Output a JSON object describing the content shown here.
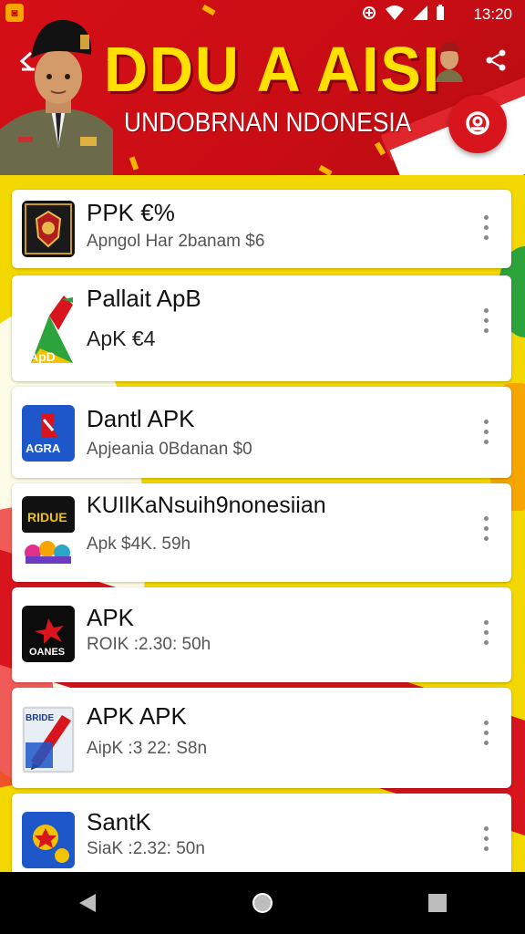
{
  "status_bar": {
    "time": "13:20"
  },
  "header": {
    "title": "DDU A AISI",
    "subtitle": "UNDOBRNAN NDONESIA"
  },
  "apps": [
    {
      "name": "PPK €%",
      "meta": "Apngol Har 2banam $6"
    },
    {
      "name": "Pallait ApB",
      "meta": "ApK €4",
      "icon_label": "ApD"
    },
    {
      "name": "Dantl APK",
      "meta": "Apjeania 0Bdanan  $0",
      "icon_label": "AGRA"
    },
    {
      "name": "KUIlKaNsuih9nonesiian",
      "meta": "Apk $4K. 59h",
      "icon_label": "RIDUE"
    },
    {
      "name": "APK",
      "meta": "ROIK :2.30: 50h",
      "icon_label": "OANES"
    },
    {
      "name": "APK APK",
      "meta": "AipK :3 22: S8n",
      "icon_label": "BRIDE"
    },
    {
      "name": "SantK",
      "meta": "SiaK :2.32: 50n"
    }
  ],
  "colors": {
    "header_red": "#d50f17",
    "title_yellow": "#ffe000",
    "background_yellow": "#f3d800"
  },
  "icons": [
    "back-icon",
    "share-icon",
    "fab-search-icon",
    "more-vert-icon",
    "nav-back-icon",
    "nav-home-icon",
    "nav-recents-icon"
  ]
}
